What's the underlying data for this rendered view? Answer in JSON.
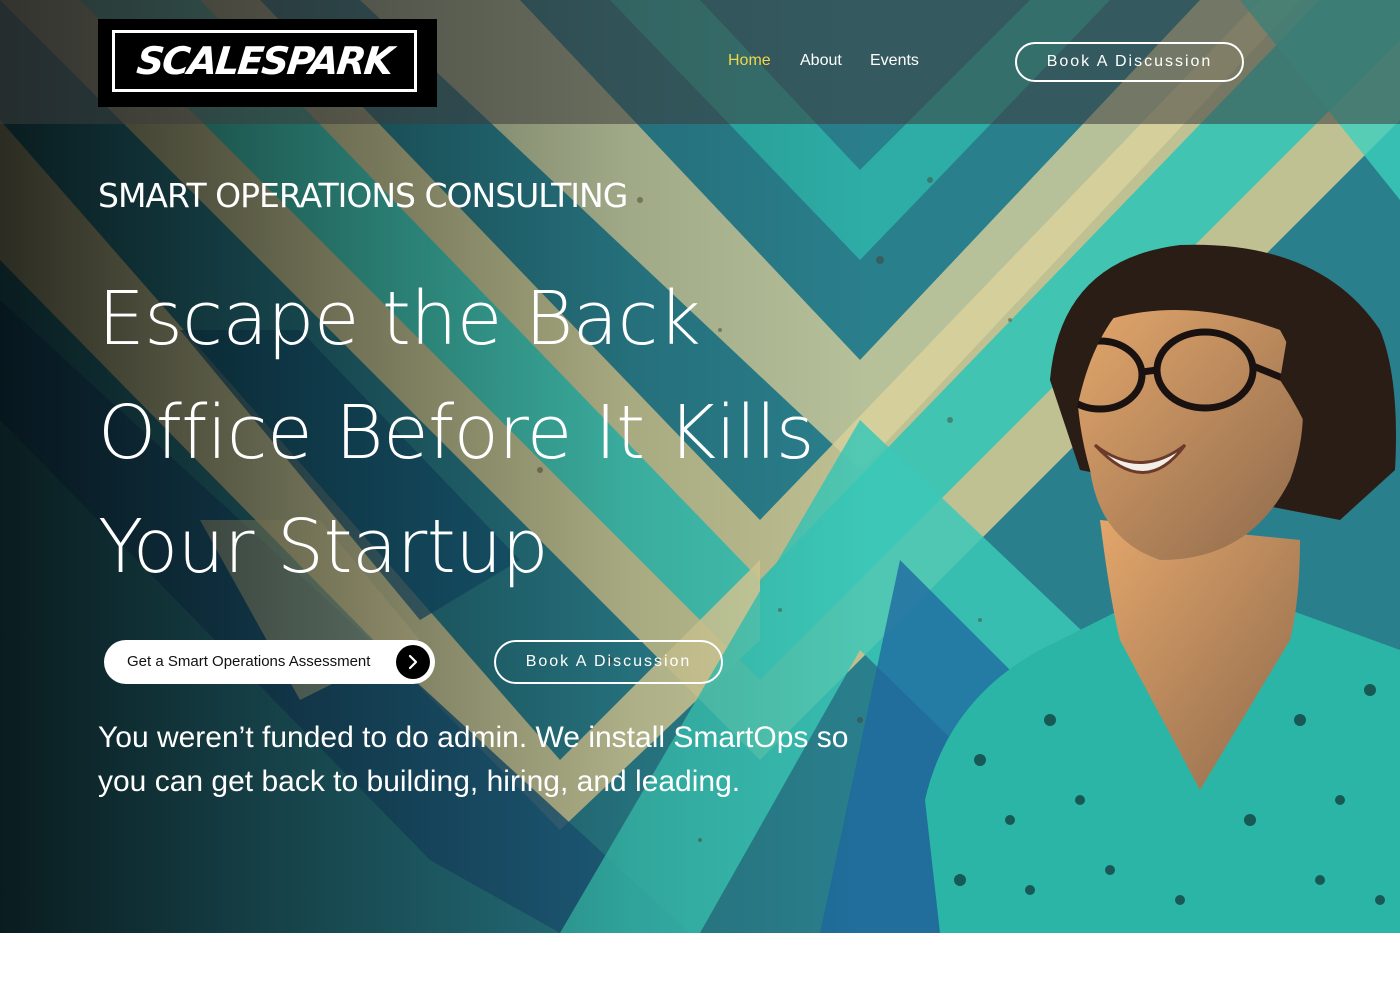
{
  "brand": {
    "logo_text": "SCALESPARK"
  },
  "nav": {
    "items": [
      {
        "label": "Home",
        "active": true
      },
      {
        "label": "About",
        "active": false
      },
      {
        "label": "Events",
        "active": false
      }
    ],
    "cta_label": "Book A Discussion"
  },
  "hero": {
    "eyebrow": "SMART OPERATIONS CONSULTING",
    "headline_lines": [
      "Escape the Back",
      "Office Before It Kills",
      "Your Startup"
    ],
    "primary_cta": "Get a Smart Operations Assessment",
    "secondary_cta": "Book A Discussion",
    "subcopy": "You weren’t funded to do admin. We install SmartOps so you can get back to building, hiring, and leading."
  },
  "icons": {
    "primary_cta_icon": "chevron-right-icon"
  },
  "colors": {
    "nav_active": "#f2d54b",
    "teal": "#35c2b3",
    "cream": "#d8d09a",
    "deep_blue": "#1d5b80"
  }
}
